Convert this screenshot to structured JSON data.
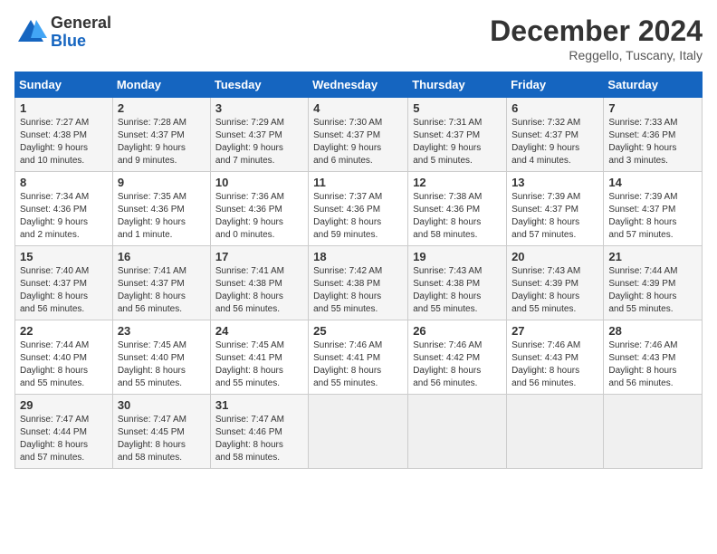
{
  "header": {
    "logo_line1": "General",
    "logo_line2": "Blue",
    "month": "December 2024",
    "location": "Reggello, Tuscany, Italy"
  },
  "days_of_week": [
    "Sunday",
    "Monday",
    "Tuesday",
    "Wednesday",
    "Thursday",
    "Friday",
    "Saturday"
  ],
  "weeks": [
    [
      {
        "day": "1",
        "info": "Sunrise: 7:27 AM\nSunset: 4:38 PM\nDaylight: 9 hours\nand 10 minutes."
      },
      {
        "day": "2",
        "info": "Sunrise: 7:28 AM\nSunset: 4:37 PM\nDaylight: 9 hours\nand 9 minutes."
      },
      {
        "day": "3",
        "info": "Sunrise: 7:29 AM\nSunset: 4:37 PM\nDaylight: 9 hours\nand 7 minutes."
      },
      {
        "day": "4",
        "info": "Sunrise: 7:30 AM\nSunset: 4:37 PM\nDaylight: 9 hours\nand 6 minutes."
      },
      {
        "day": "5",
        "info": "Sunrise: 7:31 AM\nSunset: 4:37 PM\nDaylight: 9 hours\nand 5 minutes."
      },
      {
        "day": "6",
        "info": "Sunrise: 7:32 AM\nSunset: 4:37 PM\nDaylight: 9 hours\nand 4 minutes."
      },
      {
        "day": "7",
        "info": "Sunrise: 7:33 AM\nSunset: 4:36 PM\nDaylight: 9 hours\nand 3 minutes."
      }
    ],
    [
      {
        "day": "8",
        "info": "Sunrise: 7:34 AM\nSunset: 4:36 PM\nDaylight: 9 hours\nand 2 minutes."
      },
      {
        "day": "9",
        "info": "Sunrise: 7:35 AM\nSunset: 4:36 PM\nDaylight: 9 hours\nand 1 minute."
      },
      {
        "day": "10",
        "info": "Sunrise: 7:36 AM\nSunset: 4:36 PM\nDaylight: 9 hours\nand 0 minutes."
      },
      {
        "day": "11",
        "info": "Sunrise: 7:37 AM\nSunset: 4:36 PM\nDaylight: 8 hours\nand 59 minutes."
      },
      {
        "day": "12",
        "info": "Sunrise: 7:38 AM\nSunset: 4:36 PM\nDaylight: 8 hours\nand 58 minutes."
      },
      {
        "day": "13",
        "info": "Sunrise: 7:39 AM\nSunset: 4:37 PM\nDaylight: 8 hours\nand 57 minutes."
      },
      {
        "day": "14",
        "info": "Sunrise: 7:39 AM\nSunset: 4:37 PM\nDaylight: 8 hours\nand 57 minutes."
      }
    ],
    [
      {
        "day": "15",
        "info": "Sunrise: 7:40 AM\nSunset: 4:37 PM\nDaylight: 8 hours\nand 56 minutes."
      },
      {
        "day": "16",
        "info": "Sunrise: 7:41 AM\nSunset: 4:37 PM\nDaylight: 8 hours\nand 56 minutes."
      },
      {
        "day": "17",
        "info": "Sunrise: 7:41 AM\nSunset: 4:38 PM\nDaylight: 8 hours\nand 56 minutes."
      },
      {
        "day": "18",
        "info": "Sunrise: 7:42 AM\nSunset: 4:38 PM\nDaylight: 8 hours\nand 55 minutes."
      },
      {
        "day": "19",
        "info": "Sunrise: 7:43 AM\nSunset: 4:38 PM\nDaylight: 8 hours\nand 55 minutes."
      },
      {
        "day": "20",
        "info": "Sunrise: 7:43 AM\nSunset: 4:39 PM\nDaylight: 8 hours\nand 55 minutes."
      },
      {
        "day": "21",
        "info": "Sunrise: 7:44 AM\nSunset: 4:39 PM\nDaylight: 8 hours\nand 55 minutes."
      }
    ],
    [
      {
        "day": "22",
        "info": "Sunrise: 7:44 AM\nSunset: 4:40 PM\nDaylight: 8 hours\nand 55 minutes."
      },
      {
        "day": "23",
        "info": "Sunrise: 7:45 AM\nSunset: 4:40 PM\nDaylight: 8 hours\nand 55 minutes."
      },
      {
        "day": "24",
        "info": "Sunrise: 7:45 AM\nSunset: 4:41 PM\nDaylight: 8 hours\nand 55 minutes."
      },
      {
        "day": "25",
        "info": "Sunrise: 7:46 AM\nSunset: 4:41 PM\nDaylight: 8 hours\nand 55 minutes."
      },
      {
        "day": "26",
        "info": "Sunrise: 7:46 AM\nSunset: 4:42 PM\nDaylight: 8 hours\nand 56 minutes."
      },
      {
        "day": "27",
        "info": "Sunrise: 7:46 AM\nSunset: 4:43 PM\nDaylight: 8 hours\nand 56 minutes."
      },
      {
        "day": "28",
        "info": "Sunrise: 7:46 AM\nSunset: 4:43 PM\nDaylight: 8 hours\nand 56 minutes."
      }
    ],
    [
      {
        "day": "29",
        "info": "Sunrise: 7:47 AM\nSunset: 4:44 PM\nDaylight: 8 hours\nand 57 minutes."
      },
      {
        "day": "30",
        "info": "Sunrise: 7:47 AM\nSunset: 4:45 PM\nDaylight: 8 hours\nand 58 minutes."
      },
      {
        "day": "31",
        "info": "Sunrise: 7:47 AM\nSunset: 4:46 PM\nDaylight: 8 hours\nand 58 minutes."
      },
      null,
      null,
      null,
      null
    ]
  ]
}
